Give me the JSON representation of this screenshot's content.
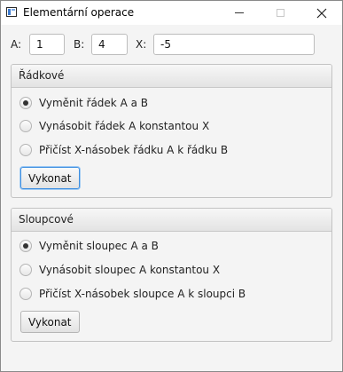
{
  "window": {
    "title": "Elementární operace",
    "icon": "app-window-icon",
    "controls": [
      "minimize-icon",
      "maximize-icon",
      "close-icon"
    ]
  },
  "inputs": {
    "a_label": "A:",
    "a_value": "1",
    "b_label": "B:",
    "b_value": "4",
    "x_label": "X:",
    "x_value": "-5"
  },
  "row_panel": {
    "title": "Řádkové",
    "options": [
      {
        "label": "Vyměnit řádek A a B",
        "selected": true
      },
      {
        "label": "Vynásobit řádek A konstantou X",
        "selected": false
      },
      {
        "label": "Přičíst X-násobek řádku A k řádku B",
        "selected": false
      }
    ],
    "button_label": "Vykonat"
  },
  "column_panel": {
    "title": "Sloupcové",
    "options": [
      {
        "label": "Vyměnit sloupec A a B",
        "selected": true
      },
      {
        "label": "Vynásobit sloupec A konstantou X",
        "selected": false
      },
      {
        "label": "Přičíst X-násobek sloupce A k sloupci B",
        "selected": false
      }
    ],
    "button_label": "Vykonat"
  },
  "colors": {
    "focus_accent": "#3d8ee0",
    "panel_border": "#c3c3c3",
    "background": "#f4f4f4"
  }
}
